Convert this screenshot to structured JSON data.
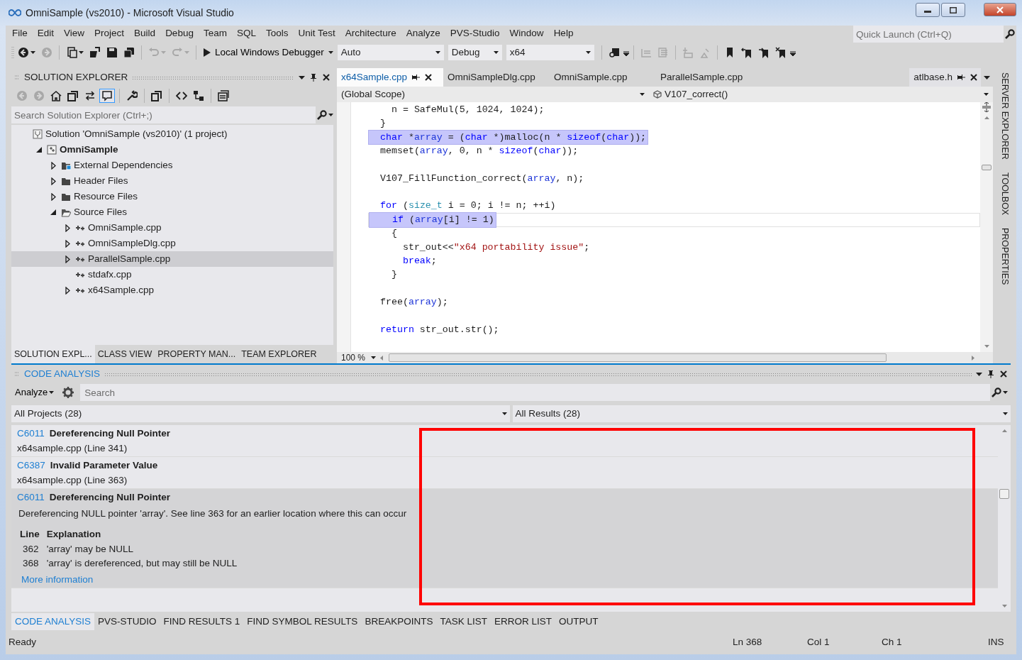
{
  "window": {
    "title": "OmniSample (vs2010) - Microsoft Visual Studio"
  },
  "menu": [
    "File",
    "Edit",
    "View",
    "Project",
    "Build",
    "Debug",
    "Team",
    "SQL",
    "Tools",
    "Unit Test",
    "Architecture",
    "Analyze",
    "PVS-Studio",
    "Window",
    "Help"
  ],
  "quick_launch": {
    "placeholder": "Quick Launch (Ctrl+Q)"
  },
  "toolbar": [
    {
      "kind": "button",
      "disabled": false,
      "dropdown": true
    },
    {
      "kind": "button",
      "disabled": true,
      "dropdown": false
    },
    {
      "kind": "separator"
    },
    {
      "kind": "button",
      "disabled": false,
      "dropdown": true
    },
    {
      "kind": "button",
      "disabled": false,
      "dropdown": false
    },
    {
      "kind": "button",
      "disabled": false,
      "dropdown": false
    },
    {
      "kind": "button",
      "disabled": false,
      "dropdown": false
    },
    {
      "kind": "separator"
    },
    {
      "kind": "button",
      "disabled": true,
      "dropdown": true
    },
    {
      "kind": "button",
      "disabled": true,
      "dropdown": true
    },
    {
      "kind": "separator"
    },
    {
      "kind": "run",
      "label": "Local Windows Debugger"
    },
    {
      "kind": "combo",
      "value": "Auto"
    },
    {
      "kind": "combo",
      "value": "Debug"
    },
    {
      "kind": "combo",
      "value": "x64"
    },
    {
      "kind": "separator"
    },
    {
      "kind": "button",
      "disabled": false,
      "dropdown": false
    },
    {
      "kind": "overflow"
    },
    {
      "kind": "separator"
    },
    {
      "kind": "button",
      "disabled": true,
      "dropdown": false
    },
    {
      "kind": "button",
      "disabled": true,
      "dropdown": false
    },
    {
      "kind": "separator"
    },
    {
      "kind": "button",
      "disabled": true,
      "dropdown": false
    },
    {
      "kind": "button",
      "disabled": true,
      "dropdown": false
    },
    {
      "kind": "separator"
    },
    {
      "kind": "button",
      "disabled": false,
      "dropdown": false
    },
    {
      "kind": "button",
      "disabled": false,
      "dropdown": false
    },
    {
      "kind": "button",
      "disabled": false,
      "dropdown": false
    },
    {
      "kind": "button",
      "disabled": false,
      "dropdown": false
    },
    {
      "kind": "overflow"
    }
  ],
  "solution_explorer": {
    "title": "SOLUTION EXPLORER",
    "toolbar": [
      {
        "kind": "button",
        "disabled": true,
        "pressed": false
      },
      {
        "kind": "button",
        "disabled": true,
        "pressed": false
      },
      {
        "kind": "button",
        "disabled": false,
        "pressed": false
      },
      {
        "kind": "button",
        "disabled": false,
        "pressed": false
      },
      {
        "kind": "button",
        "disabled": false,
        "pressed": false
      },
      {
        "kind": "button",
        "disabled": false,
        "pressed": true
      },
      {
        "kind": "separator"
      },
      {
        "kind": "button",
        "disabled": false,
        "pressed": false
      },
      {
        "kind": "separator"
      },
      {
        "kind": "button",
        "disabled": false,
        "pressed": false
      },
      {
        "kind": "separator"
      },
      {
        "kind": "button",
        "disabled": false,
        "pressed": false
      },
      {
        "kind": "button",
        "disabled": false,
        "pressed": false
      },
      {
        "kind": "separator"
      },
      {
        "kind": "button",
        "disabled": false,
        "pressed": false
      }
    ],
    "search": {
      "placeholder": "Search Solution Explorer (Ctrl+;)"
    },
    "tree": [
      {
        "label": "Solution 'OmniSample (vs2010)' (1 project)",
        "kind": "solution",
        "bold": false,
        "selected": false,
        "children": [
          {
            "label": "OmniSample",
            "kind": "project",
            "expanded": true,
            "bold": true,
            "selected": false,
            "children": [
              {
                "label": "External Dependencies",
                "kind": "dependencies",
                "expanded": false,
                "bold": false,
                "selected": false
              },
              {
                "label": "Header Files",
                "kind": "folder",
                "expanded": false,
                "bold": false,
                "selected": false
              },
              {
                "label": "Resource Files",
                "kind": "folder",
                "expanded": false,
                "bold": false,
                "selected": false
              },
              {
                "label": "Source Files",
                "kind": "folder",
                "expanded": true,
                "bold": false,
                "selected": false,
                "children": [
                  {
                    "label": "OmniSample.cpp",
                    "kind": "file",
                    "expanded": false,
                    "bold": false,
                    "selected": false
                  },
                  {
                    "label": "OmniSampleDlg.cpp",
                    "kind": "file",
                    "expanded": false,
                    "bold": false,
                    "selected": false
                  },
                  {
                    "label": "ParallelSample.cpp",
                    "kind": "file",
                    "expanded": false,
                    "bold": false,
                    "selected": true
                  },
                  {
                    "label": "stdafx.cpp",
                    "kind": "file",
                    "bold": false,
                    "selected": false
                  },
                  {
                    "label": "x64Sample.cpp",
                    "kind": "file",
                    "expanded": false,
                    "bold": false,
                    "selected": false
                  }
                ]
              }
            ]
          }
        ]
      }
    ],
    "tabs": [
      {
        "label": "SOLUTION EXPL...",
        "selected": true
      },
      {
        "label": "CLASS VIEW",
        "selected": false
      },
      {
        "label": "PROPERTY MAN...",
        "selected": false
      },
      {
        "label": "TEAM EXPLORER",
        "selected": false
      }
    ]
  },
  "document_tabs": [
    {
      "label": "x64Sample.cpp",
      "selected": true,
      "pinned": true
    },
    {
      "label": "OmniSampleDlg.cpp",
      "selected": false,
      "pinned": false
    },
    {
      "label": "OmniSample.cpp",
      "selected": false,
      "pinned": false
    },
    {
      "label": "ParallelSample.cpp",
      "selected": false,
      "pinned": false
    },
    {
      "label": "atlbase.h",
      "selected": false,
      "pinned": true
    }
  ],
  "editor": {
    "scope": "(Global Scope)",
    "member": "V107_correct()",
    "zoom": "100 %",
    "lines": [
      {
        "highlighted": false,
        "current": false,
        "segments": [
          {
            "kind": "plain",
            "text": "  n = SafeMul(5, 1024, 1024);"
          }
        ]
      },
      {
        "highlighted": false,
        "current": false,
        "segments": [
          {
            "kind": "plain",
            "text": "}"
          }
        ]
      },
      {
        "highlighted": true,
        "current": false,
        "segments": [
          {
            "kind": "keyword",
            "text": "char"
          },
          {
            "kind": "plain",
            "text": " *"
          },
          {
            "kind": "ref",
            "text": "array"
          },
          {
            "kind": "plain",
            "text": " = ("
          },
          {
            "kind": "keyword",
            "text": "char"
          },
          {
            "kind": "plain",
            "text": " *)malloc(n * "
          },
          {
            "kind": "keyword",
            "text": "sizeof"
          },
          {
            "kind": "plain",
            "text": "("
          },
          {
            "kind": "keyword",
            "text": "char"
          },
          {
            "kind": "plain",
            "text": "));"
          }
        ]
      },
      {
        "highlighted": false,
        "current": false,
        "segments": [
          {
            "kind": "plain",
            "text": "memset("
          },
          {
            "kind": "ref",
            "text": "array"
          },
          {
            "kind": "plain",
            "text": ", 0, n * "
          },
          {
            "kind": "keyword",
            "text": "sizeof"
          },
          {
            "kind": "plain",
            "text": "("
          },
          {
            "kind": "keyword",
            "text": "char"
          },
          {
            "kind": "plain",
            "text": "));"
          }
        ]
      },
      {
        "highlighted": false,
        "current": false
      },
      {
        "highlighted": false,
        "current": false,
        "segments": [
          {
            "kind": "plain",
            "text": "V107_FillFunction_correct("
          },
          {
            "kind": "ref",
            "text": "array"
          },
          {
            "kind": "plain",
            "text": ", n);"
          }
        ]
      },
      {
        "highlighted": false,
        "current": false
      },
      {
        "highlighted": false,
        "current": false,
        "segments": [
          {
            "kind": "keyword",
            "text": "for"
          },
          {
            "kind": "plain",
            "text": " ("
          },
          {
            "kind": "type",
            "text": "size_t"
          },
          {
            "kind": "plain",
            "text": " i = 0; i != n; ++i)"
          }
        ]
      },
      {
        "highlighted": true,
        "current": true,
        "segments": [
          {
            "kind": "keyword",
            "text": "  if"
          },
          {
            "kind": "plain",
            "text": " ("
          },
          {
            "kind": "ref",
            "text": "array"
          },
          {
            "kind": "plain",
            "text": "[i] != 1)"
          }
        ]
      },
      {
        "highlighted": false,
        "current": false,
        "segments": [
          {
            "kind": "plain",
            "text": "  {"
          }
        ]
      },
      {
        "highlighted": false,
        "current": false,
        "segments": [
          {
            "kind": "plain",
            "text": "    str_out<<"
          },
          {
            "kind": "string",
            "text": "\"x64 portability issue\""
          },
          {
            "kind": "plain",
            "text": ";"
          }
        ]
      },
      {
        "highlighted": false,
        "current": false,
        "segments": [
          {
            "kind": "keyword",
            "text": "    break"
          },
          {
            "kind": "plain",
            "text": ";"
          }
        ]
      },
      {
        "highlighted": false,
        "current": false,
        "segments": [
          {
            "kind": "plain",
            "text": "  }"
          }
        ]
      },
      {
        "highlighted": false,
        "current": false
      },
      {
        "highlighted": false,
        "current": false,
        "segments": [
          {
            "kind": "plain",
            "text": "free("
          },
          {
            "kind": "ref",
            "text": "array"
          },
          {
            "kind": "plain",
            "text": ");"
          }
        ]
      },
      {
        "highlighted": false,
        "current": false
      },
      {
        "highlighted": false,
        "current": false,
        "segments": [
          {
            "kind": "keyword",
            "text": "return"
          },
          {
            "kind": "plain",
            "text": " str_out.str();"
          }
        ]
      }
    ]
  },
  "side_tabs": [
    "SERVER EXPLORER",
    "TOOLBOX",
    "PROPERTIES"
  ],
  "code_analysis": {
    "title": "CODE ANALYSIS",
    "analyze": "Analyze",
    "search": {
      "placeholder": "Search"
    },
    "project_filter": "All Projects (28)",
    "result_filter": "All Results (28)",
    "results": [
      {
        "code": "C6011",
        "title": "Dereferencing Null Pointer",
        "location": "x64sample.cpp (Line 341)",
        "selected": false
      },
      {
        "code": "C6387",
        "title": "Invalid Parameter Value",
        "location": "x64sample.cpp (Line 363)",
        "selected": false
      },
      {
        "code": "C6011",
        "title": "Dereferencing Null Pointer",
        "selected": true,
        "description": "Dereferencing NULL pointer 'array'. See line 363 for an earlier location where this can occur",
        "columns": [
          "Line",
          "Explanation"
        ],
        "steps": [
          {
            "line": "362",
            "text": "'array' may be NULL"
          },
          {
            "line": "368",
            "text": "'array' is dereferenced, but may still be NULL"
          }
        ],
        "link": "More information"
      }
    ],
    "overlay_frame": {
      "color": "#ff0000"
    }
  },
  "bottom_tabs": [
    {
      "label": "CODE ANALYSIS",
      "selected": true
    },
    {
      "label": "PVS-STUDIO",
      "selected": false
    },
    {
      "label": "FIND RESULTS 1",
      "selected": false
    },
    {
      "label": "FIND SYMBOL RESULTS",
      "selected": false
    },
    {
      "label": "BREAKPOINTS",
      "selected": false
    },
    {
      "label": "TASK LIST",
      "selected": false
    },
    {
      "label": "ERROR LIST",
      "selected": false
    },
    {
      "label": "OUTPUT",
      "selected": false
    }
  ],
  "status_bar": {
    "message": "Ready",
    "line": "Ln 368",
    "column": "Col 1",
    "char": "Ch 1",
    "mode": "INS"
  }
}
